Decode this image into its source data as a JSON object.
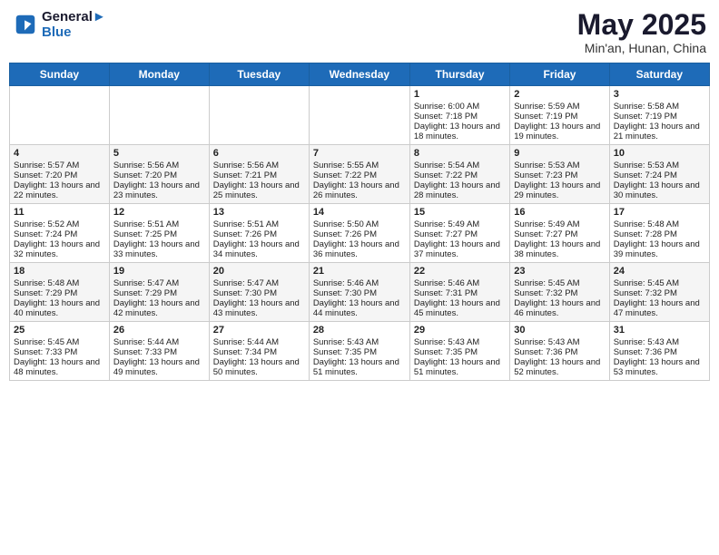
{
  "header": {
    "logo_line1": "General",
    "logo_line2": "Blue",
    "title": "May 2025",
    "location": "Min'an, Hunan, China"
  },
  "weekdays": [
    "Sunday",
    "Monday",
    "Tuesday",
    "Wednesday",
    "Thursday",
    "Friday",
    "Saturday"
  ],
  "weeks": [
    [
      {
        "day": "",
        "empty": true
      },
      {
        "day": "",
        "empty": true
      },
      {
        "day": "",
        "empty": true
      },
      {
        "day": "",
        "empty": true
      },
      {
        "day": "1",
        "sunrise": "6:00 AM",
        "sunset": "7:18 PM",
        "daylight": "13 hours and 18 minutes."
      },
      {
        "day": "2",
        "sunrise": "5:59 AM",
        "sunset": "7:19 PM",
        "daylight": "13 hours and 19 minutes."
      },
      {
        "day": "3",
        "sunrise": "5:58 AM",
        "sunset": "7:19 PM",
        "daylight": "13 hours and 21 minutes."
      }
    ],
    [
      {
        "day": "4",
        "sunrise": "5:57 AM",
        "sunset": "7:20 PM",
        "daylight": "13 hours and 22 minutes."
      },
      {
        "day": "5",
        "sunrise": "5:56 AM",
        "sunset": "7:20 PM",
        "daylight": "13 hours and 23 minutes."
      },
      {
        "day": "6",
        "sunrise": "5:56 AM",
        "sunset": "7:21 PM",
        "daylight": "13 hours and 25 minutes."
      },
      {
        "day": "7",
        "sunrise": "5:55 AM",
        "sunset": "7:22 PM",
        "daylight": "13 hours and 26 minutes."
      },
      {
        "day": "8",
        "sunrise": "5:54 AM",
        "sunset": "7:22 PM",
        "daylight": "13 hours and 28 minutes."
      },
      {
        "day": "9",
        "sunrise": "5:53 AM",
        "sunset": "7:23 PM",
        "daylight": "13 hours and 29 minutes."
      },
      {
        "day": "10",
        "sunrise": "5:53 AM",
        "sunset": "7:24 PM",
        "daylight": "13 hours and 30 minutes."
      }
    ],
    [
      {
        "day": "11",
        "sunrise": "5:52 AM",
        "sunset": "7:24 PM",
        "daylight": "13 hours and 32 minutes."
      },
      {
        "day": "12",
        "sunrise": "5:51 AM",
        "sunset": "7:25 PM",
        "daylight": "13 hours and 33 minutes."
      },
      {
        "day": "13",
        "sunrise": "5:51 AM",
        "sunset": "7:26 PM",
        "daylight": "13 hours and 34 minutes."
      },
      {
        "day": "14",
        "sunrise": "5:50 AM",
        "sunset": "7:26 PM",
        "daylight": "13 hours and 36 minutes."
      },
      {
        "day": "15",
        "sunrise": "5:49 AM",
        "sunset": "7:27 PM",
        "daylight": "13 hours and 37 minutes."
      },
      {
        "day": "16",
        "sunrise": "5:49 AM",
        "sunset": "7:27 PM",
        "daylight": "13 hours and 38 minutes."
      },
      {
        "day": "17",
        "sunrise": "5:48 AM",
        "sunset": "7:28 PM",
        "daylight": "13 hours and 39 minutes."
      }
    ],
    [
      {
        "day": "18",
        "sunrise": "5:48 AM",
        "sunset": "7:29 PM",
        "daylight": "13 hours and 40 minutes."
      },
      {
        "day": "19",
        "sunrise": "5:47 AM",
        "sunset": "7:29 PM",
        "daylight": "13 hours and 42 minutes."
      },
      {
        "day": "20",
        "sunrise": "5:47 AM",
        "sunset": "7:30 PM",
        "daylight": "13 hours and 43 minutes."
      },
      {
        "day": "21",
        "sunrise": "5:46 AM",
        "sunset": "7:30 PM",
        "daylight": "13 hours and 44 minutes."
      },
      {
        "day": "22",
        "sunrise": "5:46 AM",
        "sunset": "7:31 PM",
        "daylight": "13 hours and 45 minutes."
      },
      {
        "day": "23",
        "sunrise": "5:45 AM",
        "sunset": "7:32 PM",
        "daylight": "13 hours and 46 minutes."
      },
      {
        "day": "24",
        "sunrise": "5:45 AM",
        "sunset": "7:32 PM",
        "daylight": "13 hours and 47 minutes."
      }
    ],
    [
      {
        "day": "25",
        "sunrise": "5:45 AM",
        "sunset": "7:33 PM",
        "daylight": "13 hours and 48 minutes."
      },
      {
        "day": "26",
        "sunrise": "5:44 AM",
        "sunset": "7:33 PM",
        "daylight": "13 hours and 49 minutes."
      },
      {
        "day": "27",
        "sunrise": "5:44 AM",
        "sunset": "7:34 PM",
        "daylight": "13 hours and 50 minutes."
      },
      {
        "day": "28",
        "sunrise": "5:43 AM",
        "sunset": "7:35 PM",
        "daylight": "13 hours and 51 minutes."
      },
      {
        "day": "29",
        "sunrise": "5:43 AM",
        "sunset": "7:35 PM",
        "daylight": "13 hours and 51 minutes."
      },
      {
        "day": "30",
        "sunrise": "5:43 AM",
        "sunset": "7:36 PM",
        "daylight": "13 hours and 52 minutes."
      },
      {
        "day": "31",
        "sunrise": "5:43 AM",
        "sunset": "7:36 PM",
        "daylight": "13 hours and 53 minutes."
      }
    ]
  ],
  "labels": {
    "sunrise": "Sunrise:",
    "sunset": "Sunset:",
    "daylight": "Daylight hours"
  }
}
